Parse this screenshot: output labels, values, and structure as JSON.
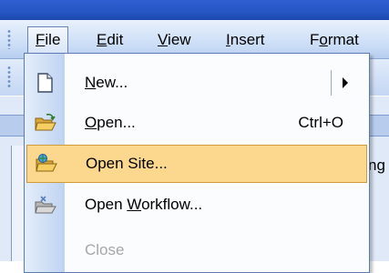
{
  "menubar": {
    "items": [
      {
        "label": "File",
        "accel": "F",
        "rest": "ile"
      },
      {
        "label": "Edit",
        "accel": "E",
        "rest": "dit"
      },
      {
        "label": "View",
        "accel": "V",
        "rest": "iew"
      },
      {
        "label": "Insert",
        "accel": "I",
        "rest": "nsert"
      },
      {
        "label": "Format",
        "pre": "F",
        "accel": "o",
        "rest": "rmat"
      }
    ]
  },
  "behind": {
    "partial_text": "ng"
  },
  "file_menu": {
    "items": [
      {
        "label": "New...",
        "accel": "N",
        "rest": "ew...",
        "icon": "new-document-icon",
        "submenu": true
      },
      {
        "label": "Open...",
        "accel": "O",
        "rest": "pen...",
        "shortcut": "Ctrl+O",
        "icon": "open-folder-icon"
      },
      {
        "label": "Open Site...",
        "icon": "open-site-icon",
        "highlighted": true
      },
      {
        "label": "Open Workflow...",
        "pre": "Open ",
        "accel": "W",
        "rest": "orkflow...",
        "icon": "open-workflow-icon"
      },
      {
        "label": "Close",
        "disabled": true
      }
    ]
  },
  "colors": {
    "highlight": "#fbd88e",
    "highlight_border": "#d19a3a",
    "menubar": "#c9dcf6",
    "disabled_text": "#a7a7a7"
  }
}
